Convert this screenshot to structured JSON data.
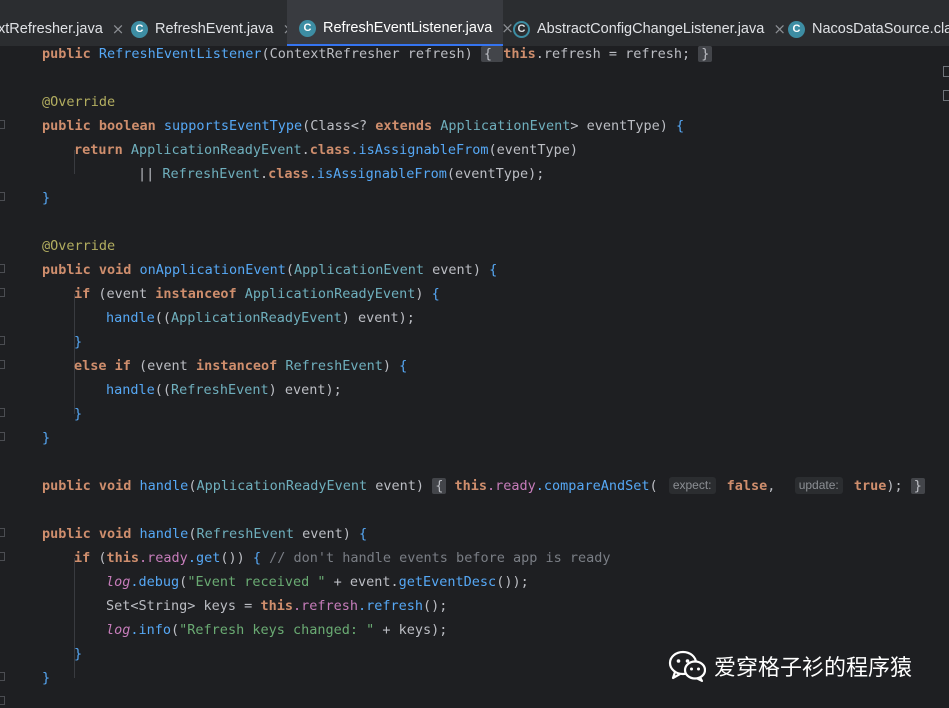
{
  "tabs": [
    {
      "label": "xtRefresher.java",
      "icon": "class-icon",
      "active": false
    },
    {
      "label": "RefreshEvent.java",
      "icon": "class-icon",
      "active": false
    },
    {
      "label": "RefreshEventListener.java",
      "icon": "class-icon",
      "active": true
    },
    {
      "label": "AbstractConfigChangeListener.java",
      "icon": "abstract-class-icon",
      "active": false
    },
    {
      "label": "NacosDataSource.clas",
      "icon": "class-icon",
      "active": false
    }
  ],
  "tab_icon_letter": "C",
  "close_glyph": "×",
  "code": {
    "line0": {
      "a": "public ",
      "b": "RefreshEventListener",
      "c": "(ContextRefresher refresh) ",
      "d": "{ ",
      "e": "this",
      "f": ".refresh = refresh; ",
      "g": "}"
    },
    "line1": {
      "ann": "@Override"
    },
    "line2": {
      "kw": "public boolean ",
      "fn": "supportsEventType",
      "p1": "(Class<? ",
      "kw2": "extends ",
      "cls": "ApplicationEvent",
      "p2": "> eventType) ",
      "brk": "{"
    },
    "line3": {
      "kw": "return ",
      "cls": "ApplicationReadyEvent",
      "dot": ".",
      "kw2": "class",
      "fn": ".isAssignableFrom",
      "p": "(eventType)"
    },
    "line4": {
      "op": "|| ",
      "cls": "RefreshEvent",
      "dot": ".",
      "kw2": "class",
      "fn": ".isAssignableFrom",
      "p": "(eventType);"
    },
    "line5": {
      "brk": "}"
    },
    "line6": {
      "ann": "@Override"
    },
    "line7": {
      "kw": "public void ",
      "fn": "onApplicationEvent",
      "p1": "(",
      "cls": "ApplicationEvent",
      "p2": " event) ",
      "brk": "{"
    },
    "line8": {
      "kw": "if ",
      "p1": "(event ",
      "kw2": "instanceof ",
      "cls": "ApplicationReadyEvent",
      "p2": ") ",
      "brk": "{"
    },
    "line9": {
      "fn": "handle",
      "p1": "((",
      "cls": "ApplicationReadyEvent",
      "p2": ") event);"
    },
    "line10": {
      "brk": "}"
    },
    "line11": {
      "kw": "else if ",
      "p1": "(event ",
      "kw2": "instanceof ",
      "cls": "RefreshEvent",
      "p2": ") ",
      "brk": "{"
    },
    "line12": {
      "fn": "handle",
      "p1": "((",
      "cls": "RefreshEvent",
      "p2": ") event);"
    },
    "line13": {
      "brk": "}"
    },
    "line14": {
      "brk": "}"
    },
    "line15": {
      "kw": "public void ",
      "fn": "handle",
      "p1": "(",
      "cls": "ApplicationReadyEvent",
      "p2": " event) ",
      "fold1": "{",
      "this": " this",
      "fld": ".ready",
      "fn2": ".compareAndSet",
      "p3": "( ",
      "hint1": "expect:",
      "kw2": " false",
      "p4": ",  ",
      "hint2": "update:",
      "kw3": " true",
      "p5": "); ",
      "fold2": "}"
    },
    "line16": {
      "kw": "public void ",
      "fn": "handle",
      "p1": "(",
      "cls": "RefreshEvent",
      "p2": " event) ",
      "brk": "{"
    },
    "line17": {
      "kw": "if ",
      "p1": "(",
      "kw2": "this",
      "fld": ".ready",
      "fn": ".get",
      "p2": "()) ",
      "brk": "{ ",
      "cmt": "// don't handle events before app is ready"
    },
    "line18": {
      "log": "log",
      "fn": ".debug",
      "p1": "(",
      "str": "\"Event received \"",
      "p2": " + event.",
      "fn2": "getEventDesc",
      "p3": "());"
    },
    "line19": {
      "typ": "Set<String> keys = ",
      "kw": "this",
      "fld": ".refresh",
      "fn": ".refresh",
      "p": "();"
    },
    "line20": {
      "log": "log",
      "fn": ".info",
      "p1": "(",
      "str": "\"Refresh keys changed: \"",
      "p2": " + keys);"
    },
    "line21": {
      "brk": "}"
    },
    "line22": {
      "brk": "}"
    }
  },
  "watermark": {
    "text": "爱穿格子衫的程序猿",
    "icon": "wechat-icon"
  }
}
